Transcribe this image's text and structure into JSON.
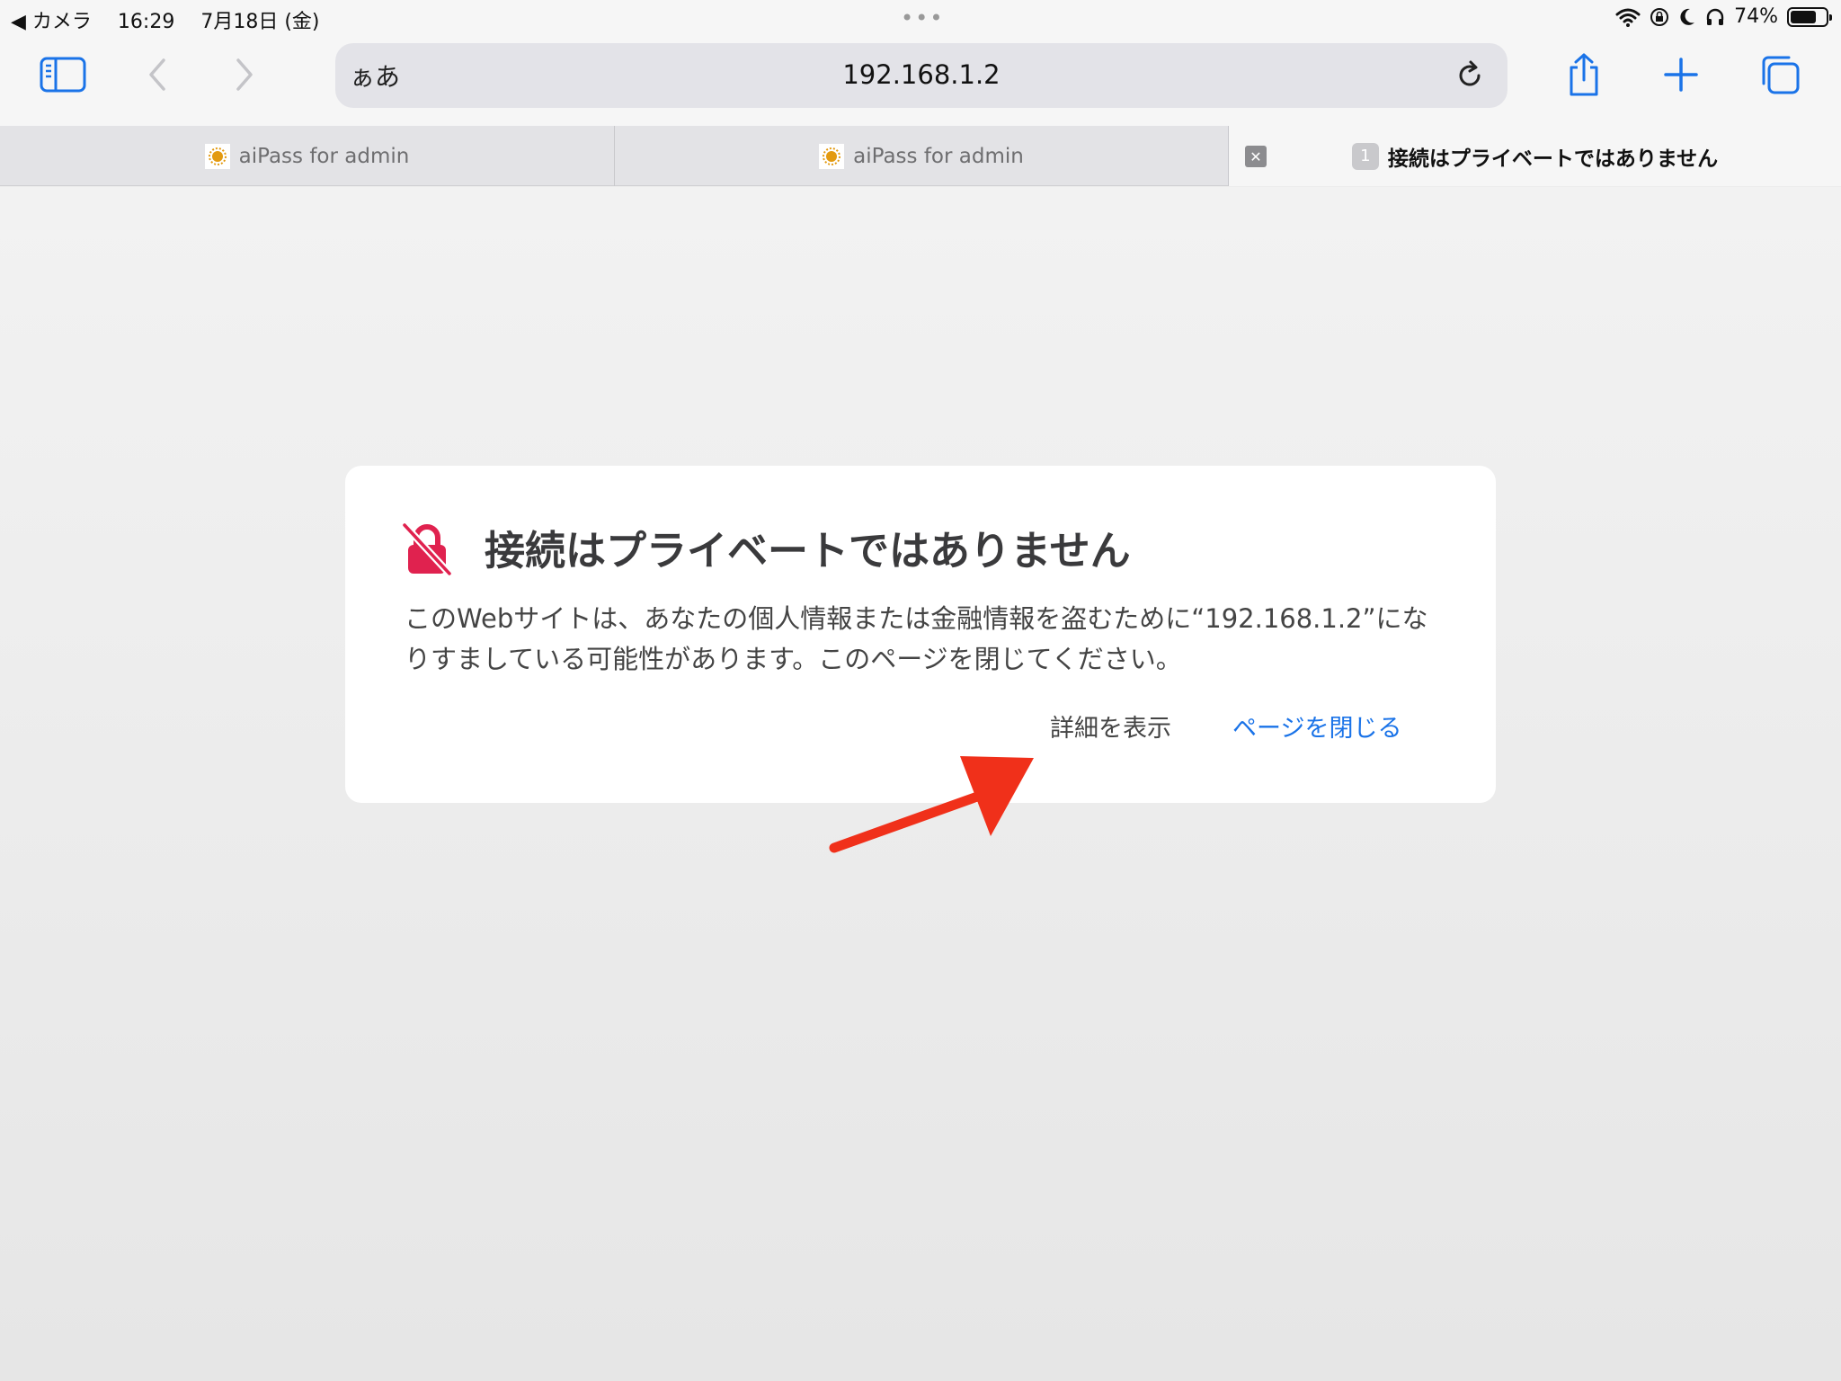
{
  "status_bar": {
    "back_app": "◀ カメラ",
    "time": "16:29",
    "date": "7月18日 (金)",
    "dots": "•••",
    "battery": "74%",
    "battery_level": 0.74
  },
  "toolbar": {
    "reader_label": "ぁあ",
    "url": "192.168.1.2"
  },
  "tabs": [
    {
      "title": "aiPass for admin"
    },
    {
      "title": "aiPass for admin"
    },
    {
      "title": "接続はプライベートではありません",
      "badge": "1"
    }
  ],
  "warning": {
    "title": "接続はプライベートではありません",
    "body": "このWebサイトは、あなたの個人情報または金融情報を盗むために“192.168.1.2”になりすましている可能性があります。このページを閉じてください。",
    "details_label": "詳細を表示",
    "close_label": "ページを閉じる"
  },
  "colors": {
    "accent": "#1a73e8",
    "warning_icon": "#e0224f",
    "annotation_arrow": "#f0301a"
  }
}
